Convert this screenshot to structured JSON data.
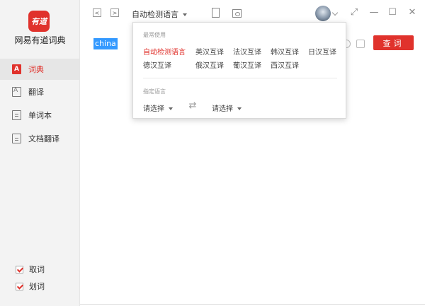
{
  "app": {
    "logo_text": "有道",
    "name": "网易有道词典"
  },
  "sidebar": {
    "items": [
      {
        "label": "词典",
        "icon": "dictionary-icon",
        "active": true
      },
      {
        "label": "翻译",
        "icon": "translate-icon",
        "active": false
      },
      {
        "label": "单词本",
        "icon": "wordbook-icon",
        "active": false
      },
      {
        "label": "文档翻译",
        "icon": "document-translate-icon",
        "active": false
      }
    ],
    "checks": [
      {
        "label": "取词",
        "checked": true
      },
      {
        "label": "划词",
        "checked": true
      }
    ]
  },
  "toolbar": {
    "back": "<",
    "forward": ">",
    "language": "自动检测语言",
    "minimize": "—",
    "maximize": "☐",
    "close": "✕",
    "restore": "⤢"
  },
  "search": {
    "value": "china",
    "button_label": "查词"
  },
  "popup": {
    "common_title": "最常使用",
    "common_langs": [
      "自动检测语言",
      "英汉互译",
      "法汉互译",
      "韩汉互译",
      "日汉互译",
      "德汉互译",
      "俄汉互译",
      "葡汉互译",
      "西汉互译"
    ],
    "specify_title": "指定语言",
    "from_placeholder": "请选择",
    "to_placeholder": "请选择",
    "swap_icon": "⇄"
  },
  "colors": {
    "accent": "#e0322c",
    "selection": "#3399ff",
    "sidebar_bg": "#f3f3f3"
  }
}
